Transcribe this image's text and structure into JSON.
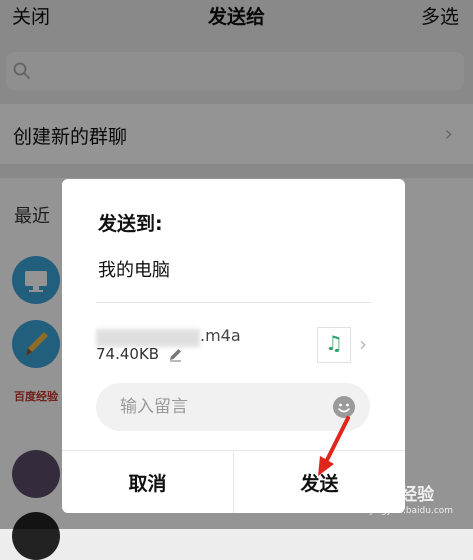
{
  "topbar": {
    "close_label": "关闭",
    "title": "发送给",
    "multi_select_label": "多选"
  },
  "search": {
    "placeholder": ""
  },
  "new_group": {
    "label": "创建新的群聊"
  },
  "recent": {
    "label": "最近",
    "contacts": [
      {
        "avatar_text": "百度经验"
      }
    ]
  },
  "dialog": {
    "title": "发送到:",
    "recipient": "我的电脑",
    "file": {
      "name_suffix": ".m4a",
      "size": "74.40KB",
      "thumb_icon": "music-note-icon"
    },
    "message": {
      "placeholder": "输入留言"
    },
    "cancel_label": "取消",
    "send_label": "发送"
  },
  "watermark": {
    "brand": "Bai 经验",
    "subtitle": "jingyan.baidu.com"
  },
  "colors": {
    "accent_green": "#2fa06a",
    "arrow_red": "#e0251b",
    "avatar_blue": "#3aa4d8"
  }
}
